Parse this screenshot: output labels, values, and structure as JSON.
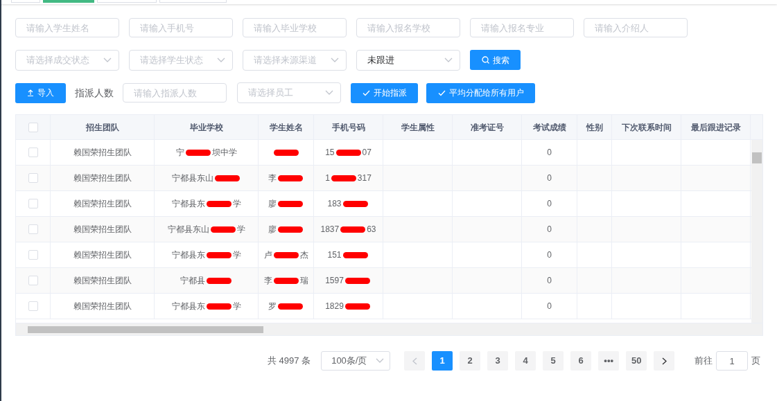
{
  "tabs": [
    {
      "selected": false
    },
    {
      "selected": true
    },
    {
      "selected": false
    },
    {
      "selected": false
    }
  ],
  "filters_row1": [
    {
      "placeholder": "请输入学生姓名"
    },
    {
      "placeholder": "请输入手机号"
    },
    {
      "placeholder": "请输入毕业学校"
    },
    {
      "placeholder": "请输入报名学校"
    },
    {
      "placeholder": "请输入报名专业"
    },
    {
      "placeholder": "请输入介绍人"
    }
  ],
  "filters_row2": [
    {
      "placeholder": "请选择成交状态"
    },
    {
      "placeholder": "请选择学生状态"
    },
    {
      "placeholder": "请选择来源渠道"
    },
    {
      "value": "未跟进"
    }
  ],
  "search_button": "搜索",
  "import_button": "导入",
  "assign_label": "指派人数",
  "assign_count": {
    "placeholder": "请输入指派人数"
  },
  "employee_select": {
    "placeholder": "请选择员工"
  },
  "start_assign_button": "开始指派",
  "distribute_button": "平均分配给所有用户",
  "table": {
    "all_checked": false,
    "columns": [
      "招生团队",
      "毕业学校",
      "学生姓名",
      "手机号码",
      "学生属性",
      "准考证号",
      "考试成绩",
      "性别",
      "下次联系时间",
      "最后跟进记录"
    ],
    "rows": [
      {
        "checked": false,
        "cells": [
          "赖国荣招生团队",
          {
            "before": "宁",
            "after": "坝中学"
          },
          {},
          {
            "before": "15",
            "after": "07"
          },
          "",
          "",
          "0",
          "",
          "",
          ""
        ]
      },
      {
        "checked": false,
        "cells": [
          "赖国荣招生团队",
          {
            "before": "宁都县东山"
          },
          {
            "before": "李"
          },
          {
            "before": "1",
            "after": "317"
          },
          "",
          "",
          "0",
          "",
          "",
          ""
        ]
      },
      {
        "checked": false,
        "cells": [
          "赖国荣招生团队",
          {
            "before": "宁都县东",
            "after": "学"
          },
          {
            "before": "廖"
          },
          {
            "before": "183"
          },
          "",
          "",
          "0",
          "",
          "",
          ""
        ]
      },
      {
        "checked": false,
        "cells": [
          "赖国荣招生团队",
          {
            "before": "宁都县东山",
            "after": "学"
          },
          {
            "before": "廖"
          },
          {
            "before": "1837",
            "after": "63"
          },
          "",
          "",
          "0",
          "",
          "",
          ""
        ]
      },
      {
        "checked": false,
        "cells": [
          "赖国荣招生团队",
          {
            "before": "宁都县东",
            "after": "学"
          },
          {
            "before": "卢",
            "after": "杰"
          },
          {
            "before": "151"
          },
          "",
          "",
          "0",
          "",
          "",
          ""
        ]
      },
      {
        "checked": false,
        "cells": [
          "赖国荣招生团队",
          {
            "before": "宁都县"
          },
          {
            "before": "李",
            "after": "瑞"
          },
          {
            "before": "1597"
          },
          "",
          "",
          "0",
          "",
          "",
          ""
        ]
      },
      {
        "checked": false,
        "cells": [
          "赖国荣招生团队",
          {
            "before": "宁都县东",
            "after": "学"
          },
          {
            "before": "罗"
          },
          {
            "before": "1829"
          },
          "",
          "",
          "0",
          "",
          "",
          ""
        ]
      }
    ]
  },
  "pagination": {
    "total": "共 4997 条",
    "page_size": "100条/页",
    "pages": [
      {
        "label": "1",
        "selected": true
      },
      {
        "label": "2",
        "selected": false
      },
      {
        "label": "3",
        "selected": false
      },
      {
        "label": "4",
        "selected": false
      },
      {
        "label": "5",
        "selected": false
      },
      {
        "label": "6",
        "selected": false
      },
      {
        "label": "•••",
        "selected": false
      },
      {
        "label": "50",
        "selected": false
      }
    ],
    "goto_label": "前往",
    "goto_value": "1",
    "page_suffix": "页"
  }
}
